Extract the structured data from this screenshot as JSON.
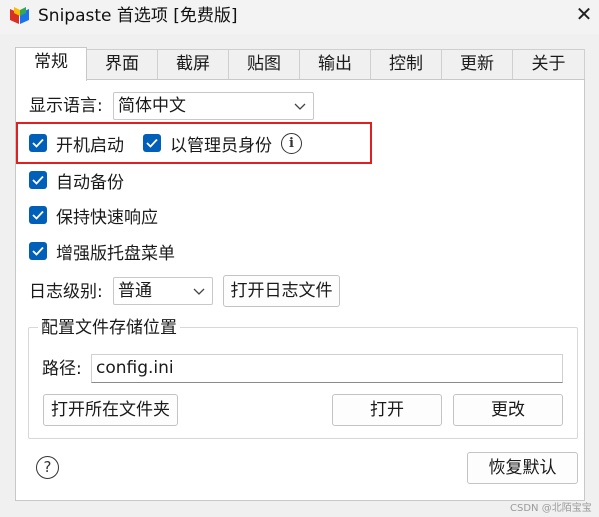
{
  "window": {
    "title": "Snipaste 首选项 [免费版]",
    "close": "✕"
  },
  "tabs": [
    {
      "label": "常规",
      "active": true
    },
    {
      "label": "界面"
    },
    {
      "label": "截屏"
    },
    {
      "label": "贴图"
    },
    {
      "label": "输出"
    },
    {
      "label": "控制"
    },
    {
      "label": "更新"
    },
    {
      "label": "关于"
    }
  ],
  "general": {
    "language_label": "显示语言:",
    "language_value": "简体中文",
    "checkboxes": {
      "startup": {
        "label": "开机启动",
        "checked": true
      },
      "as_admin": {
        "label": "以管理员身份",
        "checked": true
      },
      "auto_backup": {
        "label": "自动备份",
        "checked": true
      },
      "keep_fast": {
        "label": "保持快速响应",
        "checked": true
      },
      "tray_menu": {
        "label": "增强版托盘菜单",
        "checked": true
      }
    },
    "info_glyph": "i",
    "log_level_label": "日志级别:",
    "log_level_value": "普通",
    "open_log_button": "打开日志文件"
  },
  "config": {
    "group_title": "配置文件存储位置",
    "path_label": "路径:",
    "path_value": "config.ini",
    "open_folder_button": "打开所在文件夹",
    "open_button": "打开",
    "change_button": "更改"
  },
  "footer": {
    "help_glyph": "?",
    "restore_defaults_button": "恢复默认",
    "watermark": "CSDN @北陌宝宝"
  },
  "colors": {
    "checkbox": "#005fb8",
    "highlight": "#e02020"
  }
}
